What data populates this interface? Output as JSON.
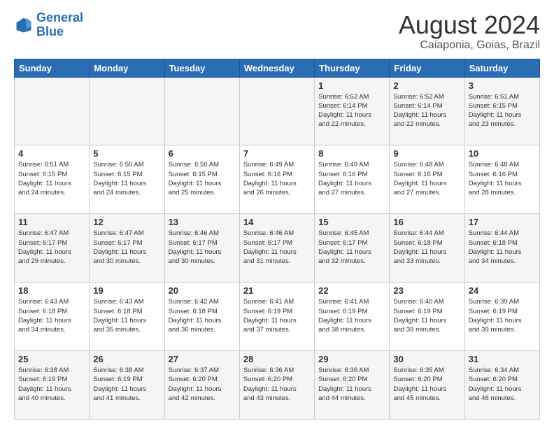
{
  "header": {
    "logo_line1": "General",
    "logo_line2": "Blue",
    "title": "August 2024",
    "subtitle": "Caiaponia, Goias, Brazil"
  },
  "days_of_week": [
    "Sunday",
    "Monday",
    "Tuesday",
    "Wednesday",
    "Thursday",
    "Friday",
    "Saturday"
  ],
  "weeks": [
    [
      {
        "day": "",
        "info": ""
      },
      {
        "day": "",
        "info": ""
      },
      {
        "day": "",
        "info": ""
      },
      {
        "day": "",
        "info": ""
      },
      {
        "day": "1",
        "info": "Sunrise: 6:52 AM\nSunset: 6:14 PM\nDaylight: 11 hours\nand 22 minutes."
      },
      {
        "day": "2",
        "info": "Sunrise: 6:52 AM\nSunset: 6:14 PM\nDaylight: 11 hours\nand 22 minutes."
      },
      {
        "day": "3",
        "info": "Sunrise: 6:51 AM\nSunset: 6:15 PM\nDaylight: 11 hours\nand 23 minutes."
      }
    ],
    [
      {
        "day": "4",
        "info": "Sunrise: 6:51 AM\nSunset: 6:15 PM\nDaylight: 11 hours\nand 24 minutes."
      },
      {
        "day": "5",
        "info": "Sunrise: 6:50 AM\nSunset: 6:15 PM\nDaylight: 11 hours\nand 24 minutes."
      },
      {
        "day": "6",
        "info": "Sunrise: 6:50 AM\nSunset: 6:15 PM\nDaylight: 11 hours\nand 25 minutes."
      },
      {
        "day": "7",
        "info": "Sunrise: 6:49 AM\nSunset: 6:16 PM\nDaylight: 11 hours\nand 26 minutes."
      },
      {
        "day": "8",
        "info": "Sunrise: 6:49 AM\nSunset: 6:16 PM\nDaylight: 11 hours\nand 27 minutes."
      },
      {
        "day": "9",
        "info": "Sunrise: 6:48 AM\nSunset: 6:16 PM\nDaylight: 11 hours\nand 27 minutes."
      },
      {
        "day": "10",
        "info": "Sunrise: 6:48 AM\nSunset: 6:16 PM\nDaylight: 11 hours\nand 28 minutes."
      }
    ],
    [
      {
        "day": "11",
        "info": "Sunrise: 6:47 AM\nSunset: 6:17 PM\nDaylight: 11 hours\nand 29 minutes."
      },
      {
        "day": "12",
        "info": "Sunrise: 6:47 AM\nSunset: 6:17 PM\nDaylight: 11 hours\nand 30 minutes."
      },
      {
        "day": "13",
        "info": "Sunrise: 6:46 AM\nSunset: 6:17 PM\nDaylight: 11 hours\nand 30 minutes."
      },
      {
        "day": "14",
        "info": "Sunrise: 6:46 AM\nSunset: 6:17 PM\nDaylight: 11 hours\nand 31 minutes."
      },
      {
        "day": "15",
        "info": "Sunrise: 6:45 AM\nSunset: 6:17 PM\nDaylight: 11 hours\nand 32 minutes."
      },
      {
        "day": "16",
        "info": "Sunrise: 6:44 AM\nSunset: 6:18 PM\nDaylight: 11 hours\nand 33 minutes."
      },
      {
        "day": "17",
        "info": "Sunrise: 6:44 AM\nSunset: 6:18 PM\nDaylight: 11 hours\nand 34 minutes."
      }
    ],
    [
      {
        "day": "18",
        "info": "Sunrise: 6:43 AM\nSunset: 6:18 PM\nDaylight: 11 hours\nand 34 minutes."
      },
      {
        "day": "19",
        "info": "Sunrise: 6:43 AM\nSunset: 6:18 PM\nDaylight: 11 hours\nand 35 minutes."
      },
      {
        "day": "20",
        "info": "Sunrise: 6:42 AM\nSunset: 6:18 PM\nDaylight: 11 hours\nand 36 minutes."
      },
      {
        "day": "21",
        "info": "Sunrise: 6:41 AM\nSunset: 6:19 PM\nDaylight: 11 hours\nand 37 minutes."
      },
      {
        "day": "22",
        "info": "Sunrise: 6:41 AM\nSunset: 6:19 PM\nDaylight: 11 hours\nand 38 minutes."
      },
      {
        "day": "23",
        "info": "Sunrise: 6:40 AM\nSunset: 6:19 PM\nDaylight: 11 hours\nand 39 minutes."
      },
      {
        "day": "24",
        "info": "Sunrise: 6:39 AM\nSunset: 6:19 PM\nDaylight: 11 hours\nand 39 minutes."
      }
    ],
    [
      {
        "day": "25",
        "info": "Sunrise: 6:38 AM\nSunset: 6:19 PM\nDaylight: 11 hours\nand 40 minutes."
      },
      {
        "day": "26",
        "info": "Sunrise: 6:38 AM\nSunset: 6:19 PM\nDaylight: 11 hours\nand 41 minutes."
      },
      {
        "day": "27",
        "info": "Sunrise: 6:37 AM\nSunset: 6:20 PM\nDaylight: 11 hours\nand 42 minutes."
      },
      {
        "day": "28",
        "info": "Sunrise: 6:36 AM\nSunset: 6:20 PM\nDaylight: 11 hours\nand 43 minutes."
      },
      {
        "day": "29",
        "info": "Sunrise: 6:36 AM\nSunset: 6:20 PM\nDaylight: 11 hours\nand 44 minutes."
      },
      {
        "day": "30",
        "info": "Sunrise: 6:35 AM\nSunset: 6:20 PM\nDaylight: 11 hours\nand 45 minutes."
      },
      {
        "day": "31",
        "info": "Sunrise: 6:34 AM\nSunset: 6:20 PM\nDaylight: 11 hours\nand 46 minutes."
      }
    ]
  ]
}
